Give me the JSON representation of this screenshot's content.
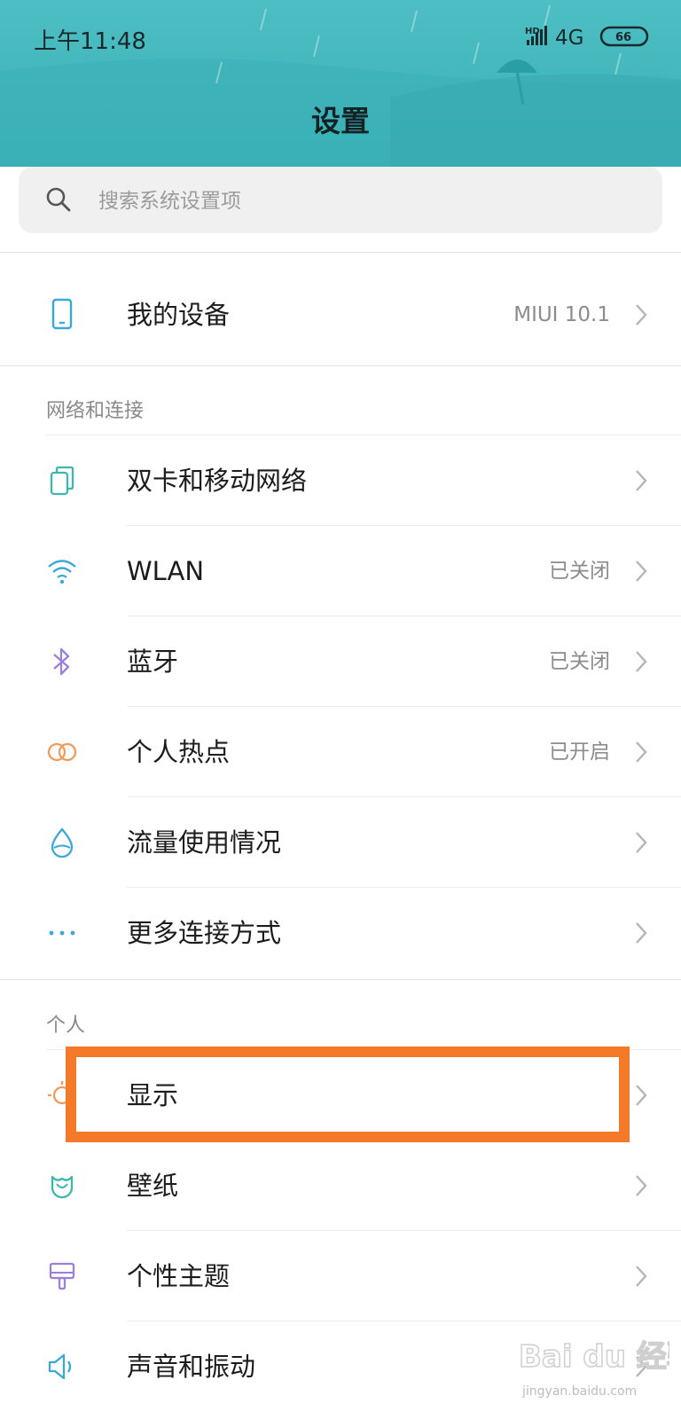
{
  "status_bar": {
    "time": "上午11:48",
    "network_hd": "HD",
    "network_type": "4G",
    "battery": "66"
  },
  "page_title": "设置",
  "search": {
    "placeholder": "搜索系统设置项",
    "icon": "search-icon"
  },
  "my_device": {
    "label": "我的设备",
    "value": "MIUI 10.1",
    "icon": "phone-icon"
  },
  "sections": [
    {
      "title": "网络和连接",
      "items": [
        {
          "label": "双卡和移动网络",
          "value": "",
          "icon": "sim-cards-icon",
          "color": "#3fb6ad"
        },
        {
          "label": "WLAN",
          "value": "已关闭",
          "icon": "wifi-icon",
          "color": "#3aa8d8"
        },
        {
          "label": "蓝牙",
          "value": "已关闭",
          "icon": "bluetooth-icon",
          "color": "#9b7fd9"
        },
        {
          "label": "个人热点",
          "value": "已开启",
          "icon": "hotspot-icon",
          "color": "#f19a5c"
        },
        {
          "label": "流量使用情况",
          "value": "",
          "icon": "data-usage-icon",
          "color": "#3aa8d8"
        },
        {
          "label": "更多连接方式",
          "value": "",
          "icon": "more-connections-icon",
          "color": "#3aa8d8"
        }
      ]
    },
    {
      "title": "个人",
      "items": [
        {
          "label": "显示",
          "value": "",
          "icon": "display-icon",
          "color": "#f19a5c"
        },
        {
          "label": "壁纸",
          "value": "",
          "icon": "wallpaper-icon",
          "color": "#3fb6ad"
        },
        {
          "label": "个性主题",
          "value": "",
          "icon": "theme-icon",
          "color": "#9b7fd9"
        },
        {
          "label": "声音和振动",
          "value": "",
          "icon": "sound-icon",
          "color": "#3aa8d8"
        }
      ]
    }
  ],
  "highlight_color": "#f47a2a",
  "watermark": {
    "brand": "Bai du 经验",
    "url": "jingyan.baidu.com"
  }
}
